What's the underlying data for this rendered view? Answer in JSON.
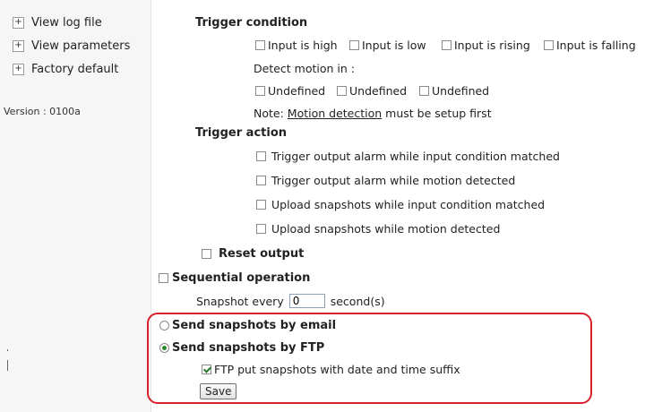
{
  "sidebar": {
    "items": [
      {
        "label": "View log file"
      },
      {
        "label": "View parameters"
      },
      {
        "label": "Factory default"
      }
    ],
    "version": "Version : 0100a"
  },
  "trigger_condition": {
    "heading": "Trigger condition",
    "inputs": [
      "Input is high",
      "Input is low",
      "Input is rising",
      "Input is falling"
    ],
    "detect_label": "Detect motion in :",
    "motion_windows": [
      "Undefined",
      "Undefined",
      "Undefined"
    ],
    "note_prefix": "Note: ",
    "note_link": "Motion detection",
    "note_suffix": " must be setup first"
  },
  "trigger_action": {
    "heading": "Trigger action",
    "options": [
      "Trigger output alarm while input condition matched",
      "Trigger output alarm while motion detected",
      "Upload snapshots while input condition matched",
      "Upload snapshots while motion detected"
    ],
    "reset_output": "Reset output"
  },
  "sequential": {
    "label": "Sequential operation",
    "snapshot_prefix": "Snapshot every",
    "snapshot_value": "0",
    "snapshot_suffix": "second(s)"
  },
  "delivery": {
    "email_label": "Send snapshots by email",
    "ftp_label": "Send snapshots by FTP",
    "selected": "ftp",
    "ftp_suffix_label": "FTP put snapshots with date and time suffix",
    "ftp_suffix_checked": true
  },
  "save_label": "Save",
  "colors": {
    "highlight": "#d8202a",
    "sidebar_bg": "#f6f6f6",
    "check_green": "#2a8a2a"
  }
}
